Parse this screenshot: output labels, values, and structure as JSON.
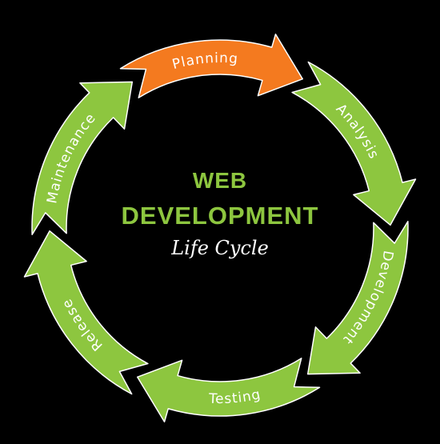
{
  "title": {
    "line1": "WEB",
    "line2": "DEVELOPMENT",
    "subtitle": "Life Cycle"
  },
  "stages": [
    {
      "key": "planning",
      "label": "Planning",
      "highlight": true
    },
    {
      "key": "analysis",
      "label": "Analysis",
      "highlight": false
    },
    {
      "key": "development",
      "label": "Development",
      "highlight": false
    },
    {
      "key": "testing",
      "label": "Testing",
      "highlight": false
    },
    {
      "key": "release",
      "label": "Release",
      "highlight": false
    },
    {
      "key": "maintenance",
      "label": "Maintenance",
      "highlight": false
    }
  ],
  "colors": {
    "background": "#000000",
    "arrow": "#8dc63f",
    "highlight": "#f47a1f",
    "outline": "#ffffff",
    "title": "#8dc63f",
    "subtitle": "#ffffff"
  }
}
